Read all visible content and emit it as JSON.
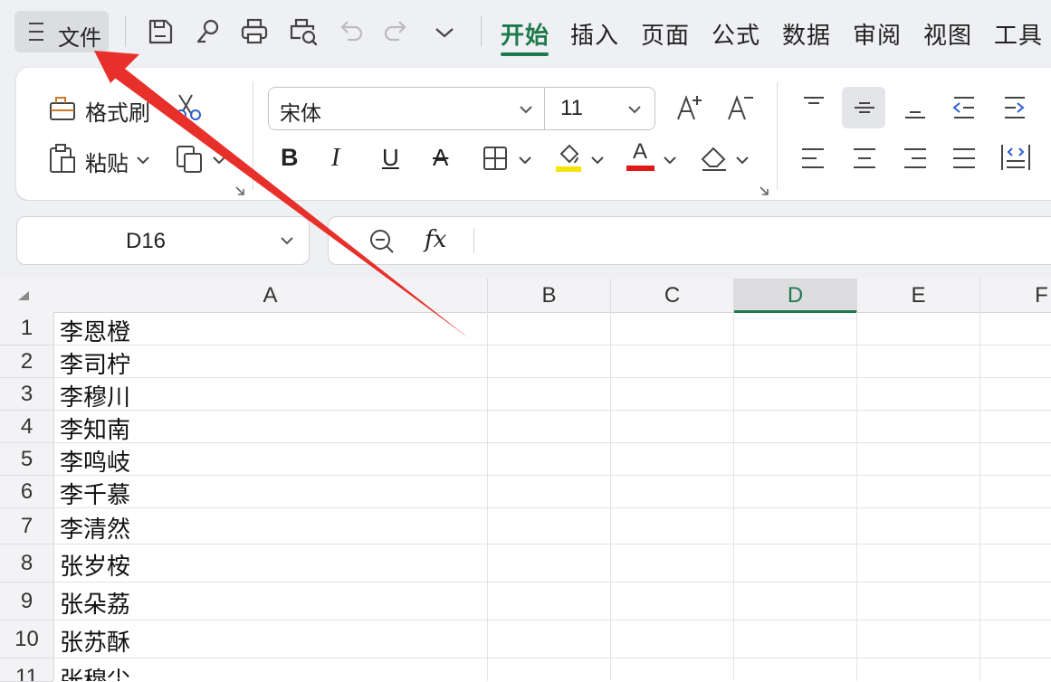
{
  "menu": {
    "file_label": "文件",
    "tabs": [
      "开始",
      "插入",
      "页面",
      "公式",
      "数据",
      "审阅",
      "视图",
      "工具"
    ],
    "active_tab": "开始"
  },
  "quick_access": [
    "save-icon",
    "save-as-icon",
    "print-icon",
    "print-preview-icon",
    "undo-icon",
    "redo-icon",
    "more-chevron-icon"
  ],
  "ribbon": {
    "format_painter_label": "格式刷",
    "paste_label": "粘贴",
    "font_name": "宋体",
    "font_size": "11",
    "bold": "B",
    "italic": "I",
    "underline": "U",
    "strike": "A",
    "font_color_letter": "A",
    "fill_color": "#f5e50a",
    "font_color": "#e01818"
  },
  "formula_bar": {
    "cell_ref": "D16",
    "fx": "fx",
    "formula_value": ""
  },
  "sheet": {
    "columns": [
      "A",
      "B",
      "C",
      "D",
      "E",
      "F"
    ],
    "selected_column": "D",
    "rows": [
      {
        "num": "1",
        "a": "李恩橙"
      },
      {
        "num": "2",
        "a": "李司柠"
      },
      {
        "num": "3",
        "a": "李穆川"
      },
      {
        "num": "4",
        "a": "李知南"
      },
      {
        "num": "5",
        "a": "李鸣岐"
      },
      {
        "num": "6",
        "a": "李千慕"
      },
      {
        "num": "7",
        "a": "李清然"
      },
      {
        "num": "8",
        "a": "张岁桉"
      },
      {
        "num": "9",
        "a": "张朵荔"
      },
      {
        "num": "10",
        "a": "张苏酥"
      },
      {
        "num": "11",
        "a": "张穆尘"
      }
    ]
  },
  "colors": {
    "accent": "#1e7a4c",
    "arrow": "#e8302a"
  }
}
